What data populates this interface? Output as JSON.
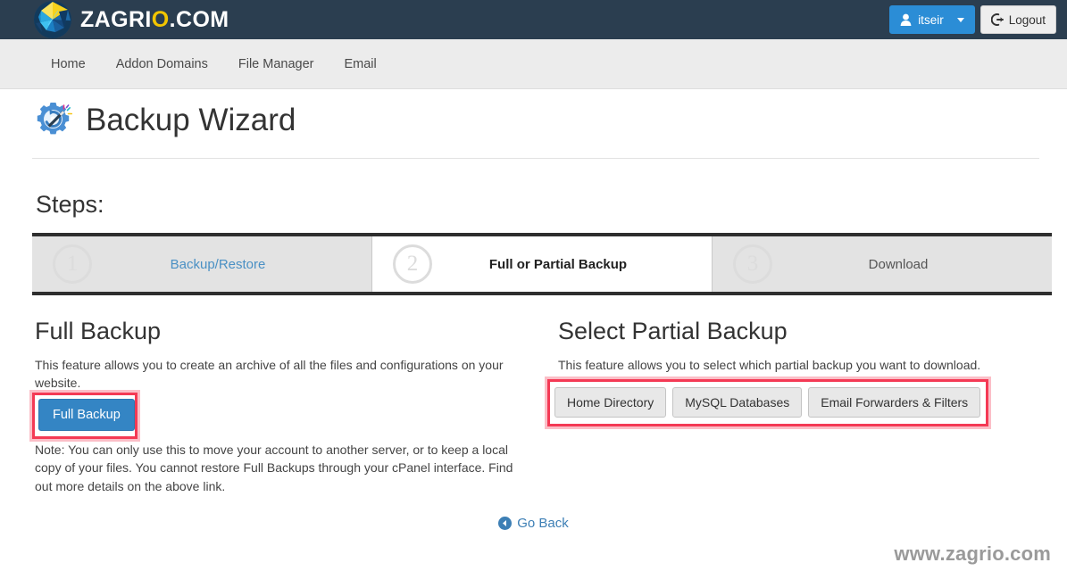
{
  "topbar": {
    "brand_main": "ZAGRI",
    "brand_accent": "O",
    "brand_tail": ".COM",
    "logo_icon": "zagrio-logo-icon",
    "user_label": "itseir",
    "user_icon": "user-icon",
    "logout_label": "Logout",
    "logout_icon": "logout-icon",
    "accent_color": "#2b8dd6",
    "background_color": "#2b3e50"
  },
  "nav": {
    "items": [
      {
        "label": "Home"
      },
      {
        "label": "Addon Domains"
      },
      {
        "label": "File Manager"
      },
      {
        "label": "Email"
      }
    ]
  },
  "page": {
    "title": "Backup Wizard",
    "title_icon": "backup-wizard-gear-wand-icon"
  },
  "steps": {
    "heading": "Steps:",
    "items": [
      {
        "number": "1",
        "label": "Backup/Restore",
        "state": "completed"
      },
      {
        "number": "2",
        "label": "Full or Partial Backup",
        "state": "active"
      },
      {
        "number": "3",
        "label": "Download",
        "state": "upcoming"
      }
    ]
  },
  "full_backup": {
    "heading": "Full Backup",
    "description": "This feature allows you to create an archive of all the files and configurations on your website.",
    "button_label": "Full Backup",
    "note": "Note: You can only use this to move your account to another server, or to keep a local copy of your files. You cannot restore Full Backups through your cPanel interface. Find out more details on the above link."
  },
  "partial_backup": {
    "heading": "Select Partial Backup",
    "description": "This feature allows you to select which partial backup you want to download.",
    "buttons": [
      {
        "label": "Home Directory"
      },
      {
        "label": "MySQL Databases"
      },
      {
        "label": "Email Forwarders & Filters"
      }
    ]
  },
  "footer": {
    "go_back_label": "Go Back",
    "go_back_icon": "arrow-left-circle-icon",
    "watermark": "www.zagrio.com"
  },
  "highlights": {
    "color": "#f43a55"
  }
}
